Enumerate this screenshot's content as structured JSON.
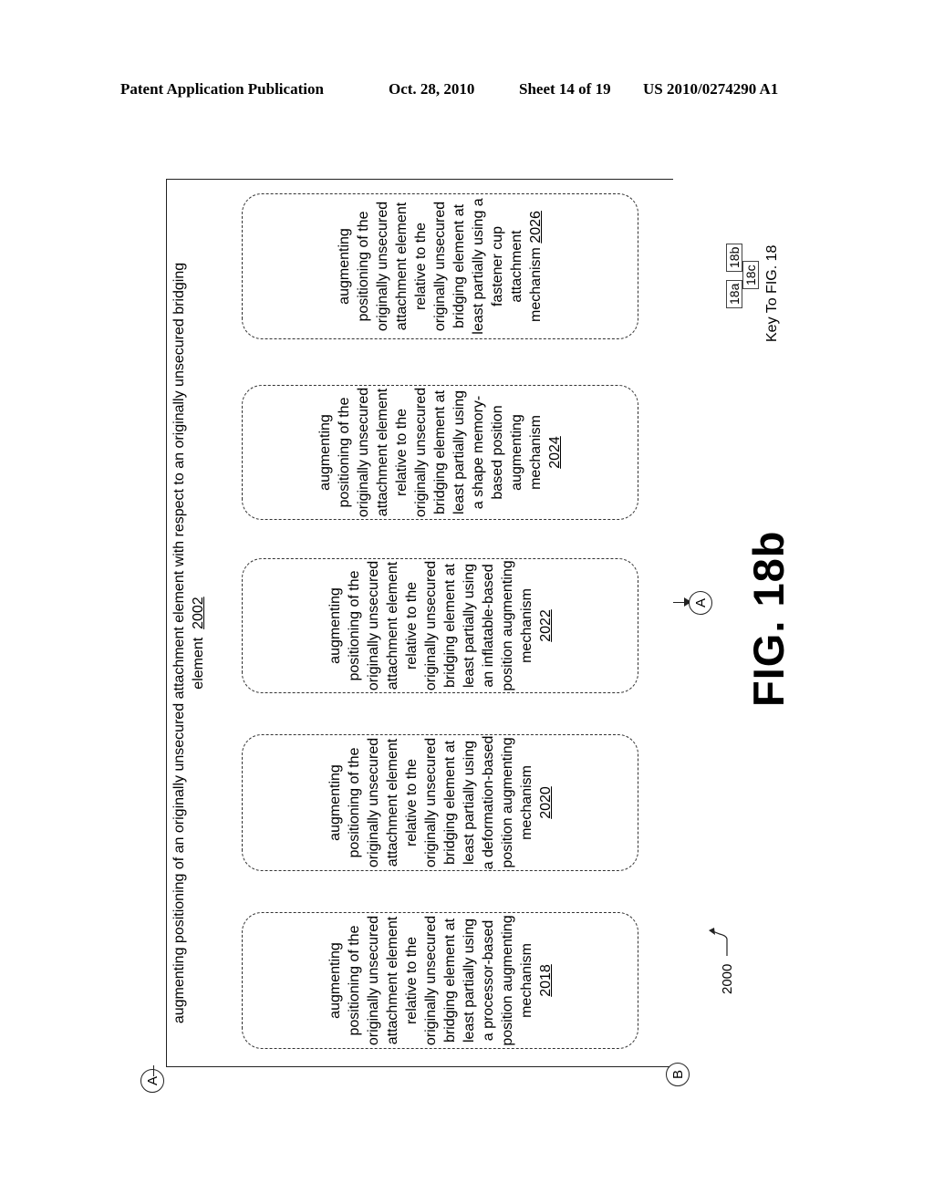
{
  "header": {
    "publication": "Patent Application Publication",
    "date": "Oct. 28, 2010",
    "sheet": "Sheet 14 of 19",
    "patent_number": "US 2010/0274290 A1"
  },
  "diagram": {
    "connector_top": "A",
    "connector_bottom": "B",
    "connector_out": "A",
    "main_block": {
      "text": "augmenting positioning of an originally unsecured attachment element with respect to an originally unsecured bridging element",
      "ref": "2002"
    },
    "boxes": [
      {
        "text": "augmenting positioning of the originally unsecured attachment element relative to the originally unsecured bridging element at least partially using a processor-based position augmenting mechanism",
        "ref": "2018"
      },
      {
        "text": "augmenting positioning of the originally unsecured attachment element relative to the originally unsecured bridging element at least partially using a deformation-based position augmenting mechanism",
        "ref": "2020"
      },
      {
        "text": "augmenting positioning of the originally unsecured attachment element relative to the originally unsecured bridging element at least partially using an inflatable-based position augmenting mechanism",
        "ref": "2022"
      },
      {
        "text": "augmenting positioning of the originally unsecured attachment element relative to the originally unsecured bridging element at least partially using a shape memory-based position augmenting mechanism",
        "ref": "2024"
      },
      {
        "text": "augmenting positioning of the originally unsecured attachment element relative to the originally unsecured bridging element at least partially using a fastener cup attachment mechanism",
        "ref": "2026"
      }
    ],
    "figure_label": "FIG. 18b",
    "figure_ref": "2000",
    "key": {
      "cells": [
        "18a",
        "18b",
        "18c"
      ],
      "caption": "Key To FIG. 18"
    }
  }
}
